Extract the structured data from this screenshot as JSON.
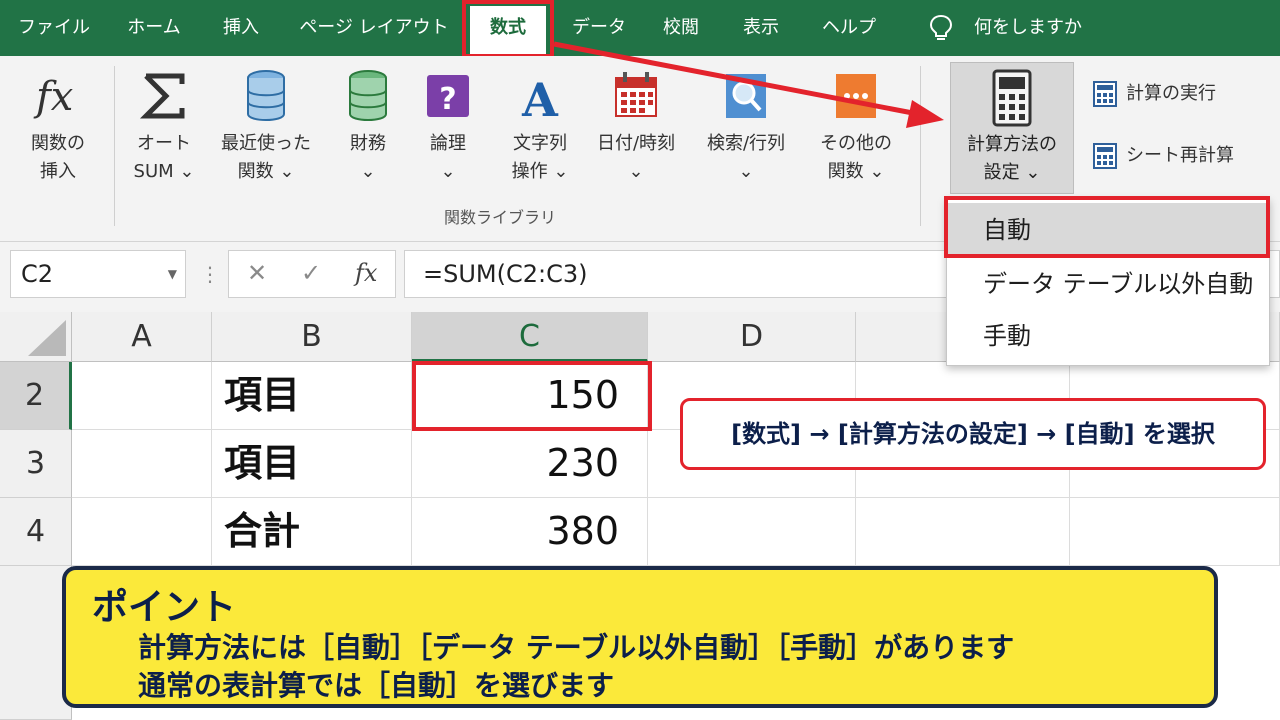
{
  "menu": {
    "tabs": [
      {
        "label": "ファイル"
      },
      {
        "label": "ホーム"
      },
      {
        "label": "挿入"
      },
      {
        "label": "ページ レイアウト"
      },
      {
        "label": "数式"
      },
      {
        "label": "データ"
      },
      {
        "label": "校閲"
      },
      {
        "label": "表示"
      },
      {
        "label": "ヘルプ"
      }
    ],
    "tell_me": "何をしますか"
  },
  "ribbon": {
    "insert_function": "関数の\n挿入",
    "autosum": "オート\nSUM ⌄",
    "recent": "最近使った\n関数 ⌄",
    "financial": "財務\n⌄",
    "logical": "論理\n⌄",
    "text": "文字列\n操作 ⌄",
    "datetime": "日付/時刻\n⌄",
    "lookup": "検索/行列\n⌄",
    "more": "その他の\n関数 ⌄",
    "group_label": "関数ライブラリ",
    "calc_options": "計算方法の\n設定 ⌄",
    "calc_now": "計算の実行",
    "calc_sheet": "シート再計算"
  },
  "dropdown": {
    "items": [
      {
        "label": "自動"
      },
      {
        "label": "データ テーブル以外自動"
      },
      {
        "label": "手動"
      }
    ]
  },
  "formula_bar": {
    "name_box": "C2",
    "formula": "=SUM(C2:C3)"
  },
  "grid": {
    "columns": [
      "A",
      "B",
      "C",
      "D"
    ],
    "rows": [
      {
        "num": "2",
        "b": "項目",
        "c": "150"
      },
      {
        "num": "3",
        "b": "項目",
        "c": "230"
      },
      {
        "num": "4",
        "b": "合計",
        "c": "380"
      }
    ]
  },
  "callout": "[数式] → [計算方法の設定] → [自動] を選択",
  "point": {
    "title": "ポイント",
    "line1": "計算方法には［自動］［データ テーブル以外自動］［手動］があります",
    "line2": "通常の表計算では［自動］を選びます"
  },
  "colors": {
    "excel_green": "#217346",
    "highlight_red": "#e3232c",
    "point_yellow": "#fbe93a",
    "point_text": "#0c1f4a"
  }
}
